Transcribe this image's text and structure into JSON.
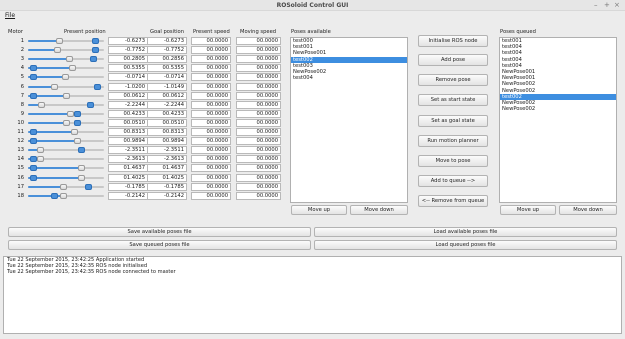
{
  "window": {
    "title": "ROSoloid Control GUI",
    "minimize_glyph": "–",
    "maximize_glyph": "+",
    "close_glyph": "×"
  },
  "menu": {
    "file": "File"
  },
  "motor_table": {
    "headers": {
      "motor": "Motor",
      "present_position": "Present position",
      "goal_position": "Goal position",
      "present_speed": "Present speed",
      "moving_speed": "Moving speed"
    },
    "rows": [
      {
        "id": "1",
        "present": "-0.6273",
        "goal": "-0.6273",
        "speed": "00.0000",
        "moving": "00.0000",
        "present_frac": 0.4,
        "goal_frac": 0.93
      },
      {
        "id": "2",
        "present": "-0.7752",
        "goal": "-0.7752",
        "speed": "00.0000",
        "moving": "00.0000",
        "present_frac": 0.38,
        "goal_frac": 0.93
      },
      {
        "id": "3",
        "present": "00.2805",
        "goal": "00.2856",
        "speed": "00.0000",
        "moving": "00.0000",
        "present_frac": 0.55,
        "goal_frac": 0.9
      },
      {
        "id": "4",
        "present": "00.5355",
        "goal": "00.5355",
        "speed": "00.0000",
        "moving": "00.0000",
        "present_frac": 0.59,
        "goal_frac": 0.03
      },
      {
        "id": "5",
        "present": "-0.0714",
        "goal": "-0.0714",
        "speed": "00.0000",
        "moving": "00.0000",
        "present_frac": 0.49,
        "goal_frac": 0.03
      },
      {
        "id": "6",
        "present": "-1.0200",
        "goal": "-1.0149",
        "speed": "00.0000",
        "moving": "00.0000",
        "present_frac": 0.34,
        "goal_frac": 0.96
      },
      {
        "id": "7",
        "present": "00.0612",
        "goal": "00.0612",
        "speed": "00.0000",
        "moving": "00.0000",
        "present_frac": 0.51,
        "goal_frac": 0.03
      },
      {
        "id": "8",
        "present": "-2.2244",
        "goal": "-2.2244",
        "speed": "00.0000",
        "moving": "00.0000",
        "present_frac": 0.15,
        "goal_frac": 0.85
      },
      {
        "id": "9",
        "present": "00.4233",
        "goal": "00.4233",
        "speed": "00.0000",
        "moving": "00.0000",
        "present_frac": 0.57,
        "goal_frac": 0.67
      },
      {
        "id": "10",
        "present": "00.0510",
        "goal": "00.0510",
        "speed": "00.0000",
        "moving": "00.0000",
        "present_frac": 0.51,
        "goal_frac": 0.67
      },
      {
        "id": "11",
        "present": "00.8313",
        "goal": "00.8313",
        "speed": "00.0000",
        "moving": "00.0000",
        "present_frac": 0.63,
        "goal_frac": 0.03
      },
      {
        "id": "12",
        "present": "00.9894",
        "goal": "00.9894",
        "speed": "00.0000",
        "moving": "00.0000",
        "present_frac": 0.66,
        "goal_frac": 0.03
      },
      {
        "id": "13",
        "present": "-2.3511",
        "goal": "-2.3511",
        "speed": "00.0000",
        "moving": "00.0000",
        "present_frac": 0.13,
        "goal_frac": 0.73
      },
      {
        "id": "14",
        "present": "-2.3613",
        "goal": "-2.3613",
        "speed": "00.0000",
        "moving": "00.0000",
        "present_frac": 0.13,
        "goal_frac": 0.03
      },
      {
        "id": "15",
        "present": "01.4637",
        "goal": "01.4637",
        "speed": "00.0000",
        "moving": "00.0000",
        "present_frac": 0.73,
        "goal_frac": 0.03
      },
      {
        "id": "16",
        "present": "01.4025",
        "goal": "01.4025",
        "speed": "00.0000",
        "moving": "00.0000",
        "present_frac": 0.72,
        "goal_frac": 0.03
      },
      {
        "id": "17",
        "present": "-0.1785",
        "goal": "-0.1785",
        "speed": "00.0000",
        "moving": "00.0000",
        "present_frac": 0.47,
        "goal_frac": 0.83
      },
      {
        "id": "18",
        "present": "-0.2142",
        "goal": "-0.2142",
        "speed": "00.0000",
        "moving": "00.0000",
        "present_frac": 0.46,
        "goal_frac": 0.33
      }
    ]
  },
  "poses_available": {
    "label": "Poses available",
    "items": [
      "test000",
      "test001",
      "NewPose001",
      "test002",
      "test003",
      "NewPose002",
      "test004"
    ],
    "selected_index": 3,
    "move_up": "Move up",
    "move_down": "Move down"
  },
  "actions": {
    "init_ros": "Initialise ROS node",
    "add_pose": "Add pose",
    "remove_pose": "Remove pose",
    "set_start": "Set as start state",
    "set_goal": "Set as goal state",
    "run_planner": "Run motion planner",
    "move_to_pose": "Move to pose",
    "add_to_queue": "Add to queue -->",
    "remove_from_queue": "<-- Remove from queue"
  },
  "poses_queued": {
    "label": "Poses queued",
    "items": [
      "test001",
      "test004",
      "test004",
      "test004",
      "test004",
      "NewPose001",
      "NewPose001",
      "NewPose002",
      "NewPose002",
      "test002",
      "NewPose002",
      "NewPose002"
    ],
    "selected_index": 9,
    "move_up": "Move up",
    "move_down": "Move down"
  },
  "files": {
    "save_available": "Save available poses file",
    "load_available": "Load available poses file",
    "save_queued": "Save queued poses file",
    "load_queued": "Load queued poses file"
  },
  "log": [
    "Tue 22 September 2015, 23:42:25 Application started",
    "Tue 22 September 2015, 23:42:35 ROS node initialised",
    "Tue 22 September 2015, 23:42:35 ROS node connected to master"
  ]
}
